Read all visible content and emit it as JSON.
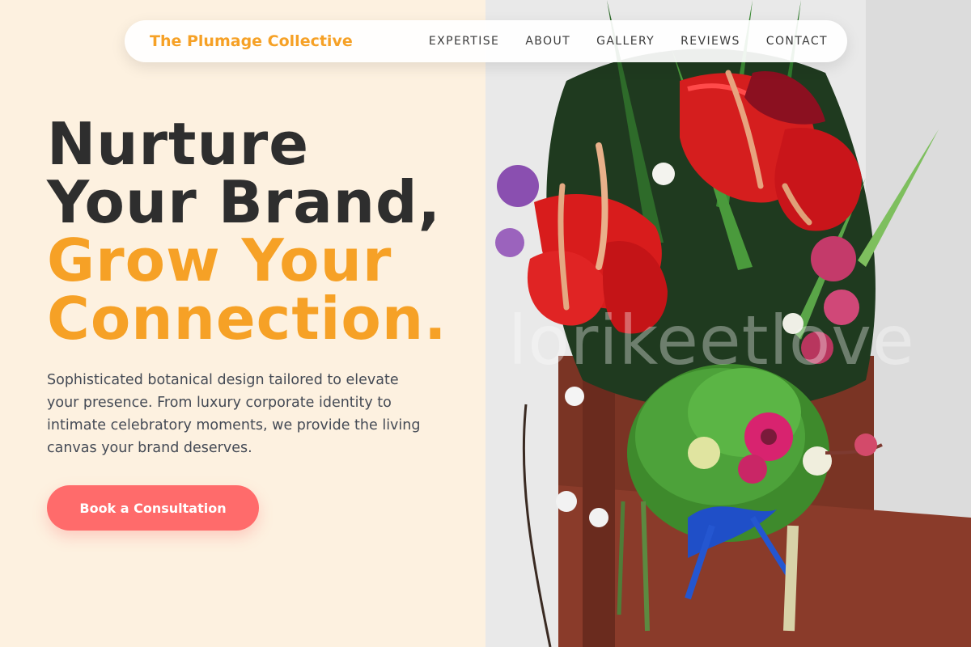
{
  "nav": {
    "brand": "The Plumage Collective",
    "links": [
      "EXPERTISE",
      "ABOUT",
      "GALLERY",
      "REVIEWS",
      "CONTACT"
    ]
  },
  "hero": {
    "headline": {
      "line1": "Nurture",
      "line2": "Your Brand,",
      "line3": "Grow Your",
      "line4": "Connection."
    },
    "description": "Sophisticated botanical design tailored to elevate your presence. From luxury corporate identity to intimate celebratory moments, we provide the living canvas your brand deserves.",
    "cta_label": "Book a Consultation"
  },
  "image": {
    "watermark": "lorikeetlove",
    "subject": "floral-bouquet-photo"
  },
  "colors": {
    "background": "#fdf1e0",
    "accent": "#f6a126",
    "cta": "#ff6b6b",
    "text_dark": "#2e2e2e",
    "text_body": "#444a55"
  }
}
